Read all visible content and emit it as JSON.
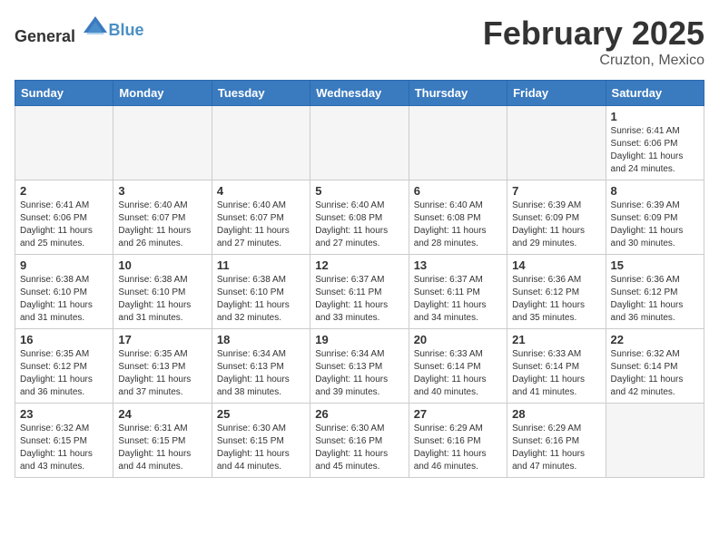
{
  "header": {
    "logo_general": "General",
    "logo_blue": "Blue",
    "month_year": "February 2025",
    "location": "Cruzton, Mexico"
  },
  "weekdays": [
    "Sunday",
    "Monday",
    "Tuesday",
    "Wednesday",
    "Thursday",
    "Friday",
    "Saturday"
  ],
  "weeks": [
    [
      {
        "day": "",
        "info": ""
      },
      {
        "day": "",
        "info": ""
      },
      {
        "day": "",
        "info": ""
      },
      {
        "day": "",
        "info": ""
      },
      {
        "day": "",
        "info": ""
      },
      {
        "day": "",
        "info": ""
      },
      {
        "day": "1",
        "info": "Sunrise: 6:41 AM\nSunset: 6:06 PM\nDaylight: 11 hours\nand 24 minutes."
      }
    ],
    [
      {
        "day": "2",
        "info": "Sunrise: 6:41 AM\nSunset: 6:06 PM\nDaylight: 11 hours\nand 25 minutes."
      },
      {
        "day": "3",
        "info": "Sunrise: 6:40 AM\nSunset: 6:07 PM\nDaylight: 11 hours\nand 26 minutes."
      },
      {
        "day": "4",
        "info": "Sunrise: 6:40 AM\nSunset: 6:07 PM\nDaylight: 11 hours\nand 27 minutes."
      },
      {
        "day": "5",
        "info": "Sunrise: 6:40 AM\nSunset: 6:08 PM\nDaylight: 11 hours\nand 27 minutes."
      },
      {
        "day": "6",
        "info": "Sunrise: 6:40 AM\nSunset: 6:08 PM\nDaylight: 11 hours\nand 28 minutes."
      },
      {
        "day": "7",
        "info": "Sunrise: 6:39 AM\nSunset: 6:09 PM\nDaylight: 11 hours\nand 29 minutes."
      },
      {
        "day": "8",
        "info": "Sunrise: 6:39 AM\nSunset: 6:09 PM\nDaylight: 11 hours\nand 30 minutes."
      }
    ],
    [
      {
        "day": "9",
        "info": "Sunrise: 6:38 AM\nSunset: 6:10 PM\nDaylight: 11 hours\nand 31 minutes."
      },
      {
        "day": "10",
        "info": "Sunrise: 6:38 AM\nSunset: 6:10 PM\nDaylight: 11 hours\nand 31 minutes."
      },
      {
        "day": "11",
        "info": "Sunrise: 6:38 AM\nSunset: 6:10 PM\nDaylight: 11 hours\nand 32 minutes."
      },
      {
        "day": "12",
        "info": "Sunrise: 6:37 AM\nSunset: 6:11 PM\nDaylight: 11 hours\nand 33 minutes."
      },
      {
        "day": "13",
        "info": "Sunrise: 6:37 AM\nSunset: 6:11 PM\nDaylight: 11 hours\nand 34 minutes."
      },
      {
        "day": "14",
        "info": "Sunrise: 6:36 AM\nSunset: 6:12 PM\nDaylight: 11 hours\nand 35 minutes."
      },
      {
        "day": "15",
        "info": "Sunrise: 6:36 AM\nSunset: 6:12 PM\nDaylight: 11 hours\nand 36 minutes."
      }
    ],
    [
      {
        "day": "16",
        "info": "Sunrise: 6:35 AM\nSunset: 6:12 PM\nDaylight: 11 hours\nand 36 minutes."
      },
      {
        "day": "17",
        "info": "Sunrise: 6:35 AM\nSunset: 6:13 PM\nDaylight: 11 hours\nand 37 minutes."
      },
      {
        "day": "18",
        "info": "Sunrise: 6:34 AM\nSunset: 6:13 PM\nDaylight: 11 hours\nand 38 minutes."
      },
      {
        "day": "19",
        "info": "Sunrise: 6:34 AM\nSunset: 6:13 PM\nDaylight: 11 hours\nand 39 minutes."
      },
      {
        "day": "20",
        "info": "Sunrise: 6:33 AM\nSunset: 6:14 PM\nDaylight: 11 hours\nand 40 minutes."
      },
      {
        "day": "21",
        "info": "Sunrise: 6:33 AM\nSunset: 6:14 PM\nDaylight: 11 hours\nand 41 minutes."
      },
      {
        "day": "22",
        "info": "Sunrise: 6:32 AM\nSunset: 6:14 PM\nDaylight: 11 hours\nand 42 minutes."
      }
    ],
    [
      {
        "day": "23",
        "info": "Sunrise: 6:32 AM\nSunset: 6:15 PM\nDaylight: 11 hours\nand 43 minutes."
      },
      {
        "day": "24",
        "info": "Sunrise: 6:31 AM\nSunset: 6:15 PM\nDaylight: 11 hours\nand 44 minutes."
      },
      {
        "day": "25",
        "info": "Sunrise: 6:30 AM\nSunset: 6:15 PM\nDaylight: 11 hours\nand 44 minutes."
      },
      {
        "day": "26",
        "info": "Sunrise: 6:30 AM\nSunset: 6:16 PM\nDaylight: 11 hours\nand 45 minutes."
      },
      {
        "day": "27",
        "info": "Sunrise: 6:29 AM\nSunset: 6:16 PM\nDaylight: 11 hours\nand 46 minutes."
      },
      {
        "day": "28",
        "info": "Sunrise: 6:29 AM\nSunset: 6:16 PM\nDaylight: 11 hours\nand 47 minutes."
      },
      {
        "day": "",
        "info": ""
      }
    ]
  ]
}
